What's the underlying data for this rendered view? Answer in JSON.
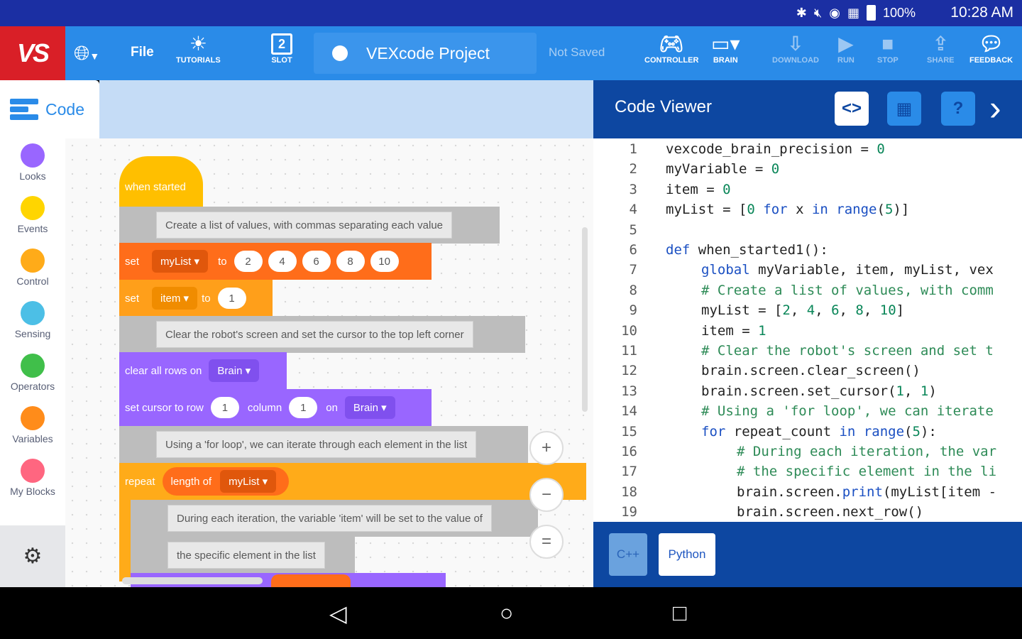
{
  "status_bar": {
    "battery": "100%",
    "time": "10:28 AM",
    "icons": [
      "bluetooth-icon",
      "mute-icon",
      "wifi-icon",
      "signal-icon",
      "battery-icon"
    ]
  },
  "toolbar": {
    "logo": "VS",
    "file": "File",
    "tutorials": "TUTORIALS",
    "slot_number": "2",
    "slot": "SLOT",
    "project_name": "VEXcode Project",
    "save_status": "Not Saved",
    "controller": "CONTROLLER",
    "brain": "BRAIN",
    "download": "DOWNLOAD",
    "run": "RUN",
    "stop": "STOP",
    "share": "SHARE",
    "feedback": "FEEDBACK"
  },
  "palette": {
    "code_tab": "Code",
    "categories": [
      {
        "label": "Looks",
        "color": "#9966ff"
      },
      {
        "label": "Events",
        "color": "#ffd500"
      },
      {
        "label": "Control",
        "color": "#ffab19"
      },
      {
        "label": "Sensing",
        "color": "#4cbfe6"
      },
      {
        "label": "Operators",
        "color": "#40bf4a"
      },
      {
        "label": "Variables",
        "color": "#ff8c1a"
      },
      {
        "label": "My Blocks",
        "color": "#ff6680"
      }
    ]
  },
  "blocks": {
    "when_started": "when started",
    "comment1": "Create a list of values, with commas separating each value",
    "set1": {
      "set": "set",
      "var": "myList",
      "to": "to",
      "values": [
        "2",
        "4",
        "6",
        "8",
        "10"
      ]
    },
    "set2": {
      "set": "set",
      "var": "item",
      "to": "to",
      "value": "1"
    },
    "comment2": "Clear the robot's screen and set the cursor to the top left corner",
    "clear": {
      "label": "clear all rows on",
      "target": "Brain"
    },
    "cursor": {
      "label": "set cursor to row",
      "row": "1",
      "column_label": "column",
      "column": "1",
      "on": "on",
      "target": "Brain"
    },
    "comment3": "Using a 'for loop', we can iterate through each element in the list",
    "repeat": {
      "label": "repeat",
      "length_of": "length of",
      "var": "myList"
    },
    "comment4": "During each iteration, the variable 'item' will be set to the value of",
    "comment5": "the specific element in the list"
  },
  "zoom": {
    "in": "+",
    "out": "−",
    "reset": "="
  },
  "code_viewer": {
    "title": "Code Viewer",
    "lines": [
      {
        "n": "1",
        "indent": 0,
        "segs": [
          [
            "t",
            "vexcode_brain_precision = "
          ],
          [
            "n",
            "0"
          ]
        ]
      },
      {
        "n": "2",
        "indent": 0,
        "segs": [
          [
            "t",
            "myVariable = "
          ],
          [
            "n",
            "0"
          ]
        ]
      },
      {
        "n": "3",
        "indent": 0,
        "segs": [
          [
            "t",
            "item = "
          ],
          [
            "n",
            "0"
          ]
        ]
      },
      {
        "n": "4",
        "indent": 0,
        "segs": [
          [
            "t",
            "myList = ["
          ],
          [
            "n",
            "0"
          ],
          [
            "t",
            " "
          ],
          [
            "k",
            "for"
          ],
          [
            "t",
            " x "
          ],
          [
            "k",
            "in"
          ],
          [
            "t",
            " "
          ],
          [
            "k",
            "range"
          ],
          [
            "t",
            "("
          ],
          [
            "n",
            "5"
          ],
          [
            "t",
            ")]"
          ]
        ]
      },
      {
        "n": "5",
        "indent": 0,
        "segs": []
      },
      {
        "n": "6",
        "indent": 0,
        "segs": [
          [
            "k",
            "def"
          ],
          [
            "t",
            " when_started1():"
          ]
        ]
      },
      {
        "n": "7",
        "indent": 1,
        "segs": [
          [
            "k",
            "global"
          ],
          [
            "t",
            " myVariable, item, myList, vex"
          ]
        ]
      },
      {
        "n": "8",
        "indent": 1,
        "segs": [
          [
            "c",
            "# Create a list of values, with comm"
          ]
        ]
      },
      {
        "n": "9",
        "indent": 1,
        "segs": [
          [
            "t",
            "myList = ["
          ],
          [
            "n",
            "2"
          ],
          [
            "t",
            ", "
          ],
          [
            "n",
            "4"
          ],
          [
            "t",
            ", "
          ],
          [
            "n",
            "6"
          ],
          [
            "t",
            ", "
          ],
          [
            "n",
            "8"
          ],
          [
            "t",
            ", "
          ],
          [
            "n",
            "10"
          ],
          [
            "t",
            "]"
          ]
        ]
      },
      {
        "n": "10",
        "indent": 1,
        "segs": [
          [
            "t",
            "item = "
          ],
          [
            "n",
            "1"
          ]
        ]
      },
      {
        "n": "11",
        "indent": 1,
        "segs": [
          [
            "c",
            "# Clear the robot's screen and set t"
          ]
        ]
      },
      {
        "n": "12",
        "indent": 1,
        "segs": [
          [
            "t",
            "brain.screen.clear_screen()"
          ]
        ]
      },
      {
        "n": "13",
        "indent": 1,
        "segs": [
          [
            "t",
            "brain.screen.set_cursor("
          ],
          [
            "n",
            "1"
          ],
          [
            "t",
            ", "
          ],
          [
            "n",
            "1"
          ],
          [
            "t",
            ")"
          ]
        ]
      },
      {
        "n": "14",
        "indent": 1,
        "segs": [
          [
            "c",
            "# Using a 'for loop', we can iterate"
          ]
        ]
      },
      {
        "n": "15",
        "indent": 1,
        "segs": [
          [
            "k",
            "for"
          ],
          [
            "t",
            " repeat_count "
          ],
          [
            "k",
            "in"
          ],
          [
            "t",
            " "
          ],
          [
            "k",
            "range"
          ],
          [
            "t",
            "("
          ],
          [
            "n",
            "5"
          ],
          [
            "t",
            "):"
          ]
        ]
      },
      {
        "n": "16",
        "indent": 2,
        "segs": [
          [
            "c",
            "# During each iteration, the var"
          ]
        ]
      },
      {
        "n": "17",
        "indent": 2,
        "segs": [
          [
            "c",
            "# the specific element in the li"
          ]
        ]
      },
      {
        "n": "18",
        "indent": 2,
        "segs": [
          [
            "t",
            "brain.screen."
          ],
          [
            "k",
            "print"
          ],
          [
            "t",
            "(myList[item -"
          ]
        ]
      },
      {
        "n": "19",
        "indent": 2,
        "segs": [
          [
            "t",
            "brain.screen.next_row()"
          ]
        ]
      }
    ],
    "languages": {
      "cpp": "C++",
      "python": "Python"
    }
  },
  "nav_bar": {
    "back": "◁",
    "home": "○",
    "recents": "□"
  }
}
